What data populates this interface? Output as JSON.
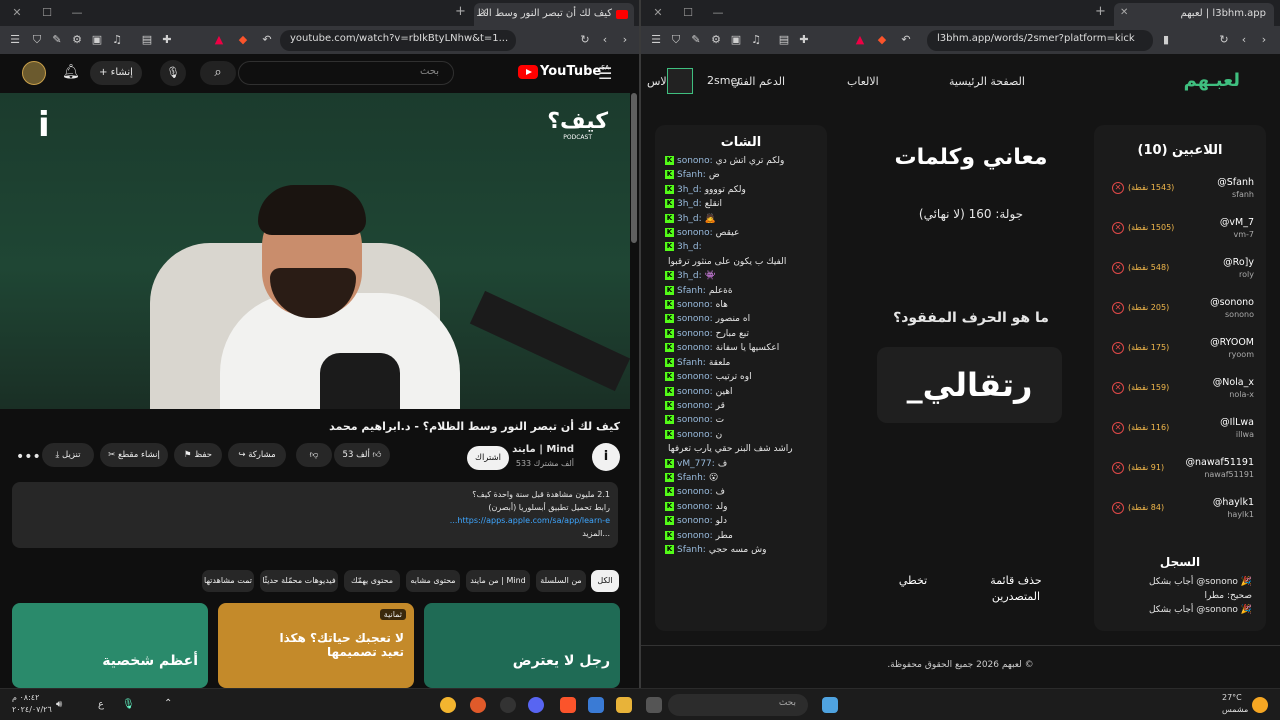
{
  "left_window": {
    "tab_title": "كيف لك أن تبصر النور وسط الظ",
    "url": "youtube.com/watch?v=rbIkBtyLNhw&t=1...",
    "youtube": {
      "search_placeholder": "بحث",
      "create_label": "إنشاء",
      "logo_text": "YouTube",
      "logo_region": "SA",
      "video_logo_text": "كيف؟",
      "video_logo_sub": "PODCAST",
      "video_title": "كيف لك أن تبصر النور وسط الظلام؟ - د.ابراهيم محمد",
      "channel_name": "مايند | Mind",
      "channel_subs": "533 ألف مشترك",
      "subscribe_label": "اشتراك",
      "like_count": "53 ألف",
      "share_label": "مشاركة",
      "save_label": "حفظ",
      "clip_label": "إنشاء مقطع",
      "download_label": "تنزيل",
      "description_line1": "2.1 مليون مشاهدة  قبل سنة واحدة  كيف؟",
      "description_line2": "رابط تحميل تطبيق أبسلوريا (أبصرن)",
      "description_link": "https://apps.apple.com/sa/app/learn-e...",
      "description_more": "...المزيد",
      "chips": [
        "الكل",
        "من السلسلة",
        "من مايند | Mind",
        "محتوى مشابه",
        "محتوى يهمّك",
        "فيديوهات محمّلة حديثًا",
        "تمت مشاهدتها"
      ],
      "thumbnails": [
        {
          "title": "رجل لا يعترض",
          "badge": "",
          "color": "#1f6b55"
        },
        {
          "title": "لا تعجبك حياتك؟ هكذا تعيد تصميمها",
          "badge": "ثمانية",
          "color": "#c48a2a"
        },
        {
          "title": "أعظم شخصية",
          "badge": "",
          "color": "#2a8a6b"
        }
      ]
    }
  },
  "right_window": {
    "tab_title": "لعبهم | l3bhm.app",
    "url": "l3bhm.app/words/2smer?platform=kick",
    "nav": {
      "logo": "لعبـهم",
      "home": "الصفحة الرئيسية",
      "games": "الالعاب",
      "support": "الدعم الفني",
      "user": "2smer",
      "extra": "الاس"
    },
    "chat_title": "الشات",
    "chat_messages": [
      {
        "user": "sonono:",
        "text": "ولكم تري اتش دي"
      },
      {
        "user": "Sfanh:",
        "text": "ض"
      },
      {
        "user": "3h_d:",
        "text": "ولكم توووو"
      },
      {
        "user": "3h_d:",
        "text": "انقلع"
      },
      {
        "user": "3h_d:",
        "text": "🙇"
      },
      {
        "user": "sonono:",
        "text": "عيقص"
      },
      {
        "user": "3h_d:",
        "text": ""
      },
      {
        "user": "",
        "text": "الفيك ب يكون على منثور ترقبوا"
      },
      {
        "user": "3h_d:",
        "text": "👾"
      },
      {
        "user": "Sfanh:",
        "text": "ةةعلم"
      },
      {
        "user": "sonono:",
        "text": "هاه"
      },
      {
        "user": "sonono:",
        "text": "اه منصور"
      },
      {
        "user": "sonono:",
        "text": "تبع مبارح"
      },
      {
        "user": "sonono:",
        "text": "اعكسيها يا سفانة"
      },
      {
        "user": "Sfanh:",
        "text": "ملعقة"
      },
      {
        "user": "sonono:",
        "text": "اوه ترتيب"
      },
      {
        "user": "sonono:",
        "text": "اهين"
      },
      {
        "user": "sonono:",
        "text": "قر"
      },
      {
        "user": "sonono:",
        "text": "ت"
      },
      {
        "user": "sonono:",
        "text": "ن"
      },
      {
        "user": "",
        "text": "راشد شف البنر حقي يارب تعرفها"
      },
      {
        "user": "vM_777:",
        "text": "ف"
      },
      {
        "user": "Sfanh:",
        "text": "😮"
      },
      {
        "user": "sonono:",
        "text": "ف"
      },
      {
        "user": "sonono:",
        "text": "ولد"
      },
      {
        "user": "sonono:",
        "text": "دلو"
      },
      {
        "user": "sonono:",
        "text": "مطر"
      },
      {
        "user": "Sfanh:",
        "text": "وش مسه حجي"
      }
    ],
    "game_title": "معاني وكلمات",
    "round_text": "جولة: 160 (لا نهائي)",
    "question": "ما هو الحرف المفقود؟",
    "word": "_رتقالي",
    "actions": {
      "skip": "تخطي",
      "delete_board": "حذف قائمة المتصدرين"
    },
    "players_title": "اللاعبين (10)",
    "players": [
      {
        "name": "@Sfanh",
        "user": "sfanh",
        "points": "(1543 نقطة)"
      },
      {
        "name": "@vM_7",
        "user": "vm-7",
        "points": "(1505 نقطة)"
      },
      {
        "name": "@Ro]y",
        "user": "roly",
        "points": "(548 نقطة)"
      },
      {
        "name": "@sonono",
        "user": "sonono",
        "points": "(205 نقطة)"
      },
      {
        "name": "@RYOOM",
        "user": "ryoom",
        "points": "(175 نقطة)"
      },
      {
        "name": "@Nola_x",
        "user": "nola-x",
        "points": "(159 نقطة)"
      },
      {
        "name": "@IlLwa",
        "user": "illwa",
        "points": "(116 نقطة)"
      },
      {
        "name": "@nawaf51191",
        "user": "nawaf51191",
        "points": "(91 نقطة)"
      },
      {
        "name": "@haylk1",
        "user": "haylk1",
        "points": "(84 نقطة)"
      }
    ],
    "log_title": "السجل",
    "log": [
      "🎉 sonono@ أجاب بشكل",
      "صحيح: مطرا",
      "🎉 sonono@ أجاب بشكل"
    ],
    "footer": "© لعبهم 2026 جميع الحقوق محفوظة."
  },
  "taskbar": {
    "search_placeholder": "بحث",
    "weather_temp": "27°C",
    "weather_desc": "مشمس",
    "time": "٠٨:٤٢ م",
    "date": "٢٠٢٤/٠٧/٢٦",
    "lang": "ع"
  }
}
